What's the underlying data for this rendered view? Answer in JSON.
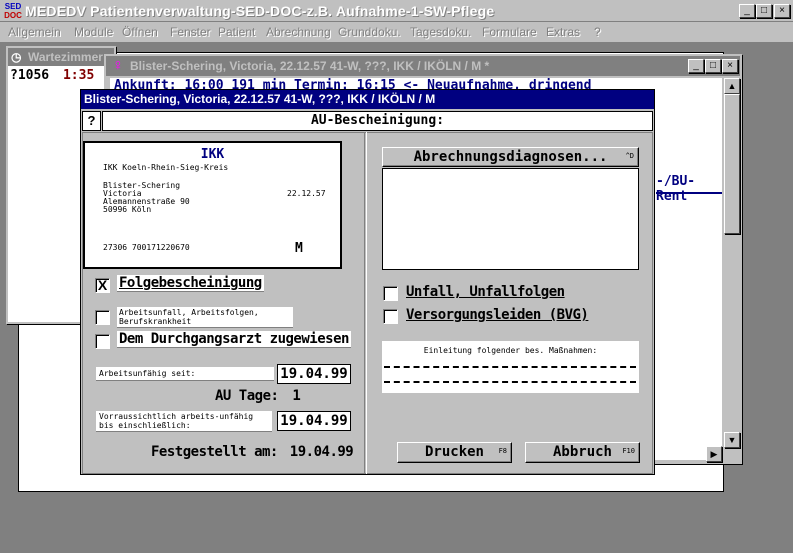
{
  "app": {
    "logo": [
      "SED",
      "DOC"
    ],
    "title": "MEDEDV Patientenverwaltung-SED-DOC-z.B. Aufnahme-1-SW-Pflege",
    "minimize": "_",
    "maximize": "□",
    "close": "×"
  },
  "menu": [
    "Allgemein",
    "Module",
    "Öffnen",
    "Fenster",
    "Patient",
    "Abrechnung",
    "Grunddoku.",
    "Tagesdoku.",
    "Formulare",
    "Extras",
    "?"
  ],
  "wartezimmer": {
    "title": "Wartezimmer",
    "entry_id": "?1056",
    "entry_time": "1:35"
  },
  "patient_window": {
    "title": "Blister-Schering, Victoria, 22.12.57 41-W, ???, IKK / IKÖLN / M *",
    "line": "Ankunft: 16:00  191 min  Termin: 16:15 <- Neuaufnahme, dringend",
    "side_text": "-/BU-Rent"
  },
  "dialog": {
    "title": "Blister-Schering, Victoria, 22.12.57 41-W, ???, IKK / IKÖLN / M",
    "help": "?",
    "heading": "AU-Bescheinigung:",
    "card": {
      "insurer": "IKK",
      "insurer_full": "IKK Koeln-Rhein-Sieg-Kreis",
      "name": "Blister-Schering",
      "firstname": "Victoria",
      "birthdate": "22.12.57",
      "street": "Alemannenstraße 90",
      "city": "50996 Köln",
      "numbers": "27306  700171220670",
      "status": "M"
    },
    "folgebescheinigung": {
      "label": "Folgebescheinigung",
      "checked": "X"
    },
    "arbeitsunfall": {
      "label": "Arbeitsunfall, Arbeitsfolgen, Berufskrankheit"
    },
    "durchgangsarzt": {
      "label": "Dem Durchgangsarzt zugewiesen"
    },
    "arbeitsunfaehig_seit": {
      "label": "Arbeitsunfähig seit:",
      "value": "19.04.99"
    },
    "au_tage": {
      "label": "AU Tage:",
      "value": "1"
    },
    "voraussichtlich": {
      "label": "Vorraussichtlich arbeits-unfähig bis einschließlich:",
      "value": "19.04.99"
    },
    "festgestellt": {
      "label": "Festgestellt am:",
      "value": "19.04.99"
    },
    "diagnosen_button": {
      "label": "Abrechnungsdiagnosen...",
      "key": "^D"
    },
    "unfall": {
      "label": "Unfall, Unfallfolgen"
    },
    "versorgung": {
      "label": "Versorgungsleiden (BVG)"
    },
    "einleitung": {
      "label": "Einleitung folgender bes. Maßnahmen:"
    },
    "drucken": {
      "label": "Drucken",
      "key": "F8"
    },
    "abbruch": {
      "label": "Abbruch",
      "key": "F10"
    }
  }
}
